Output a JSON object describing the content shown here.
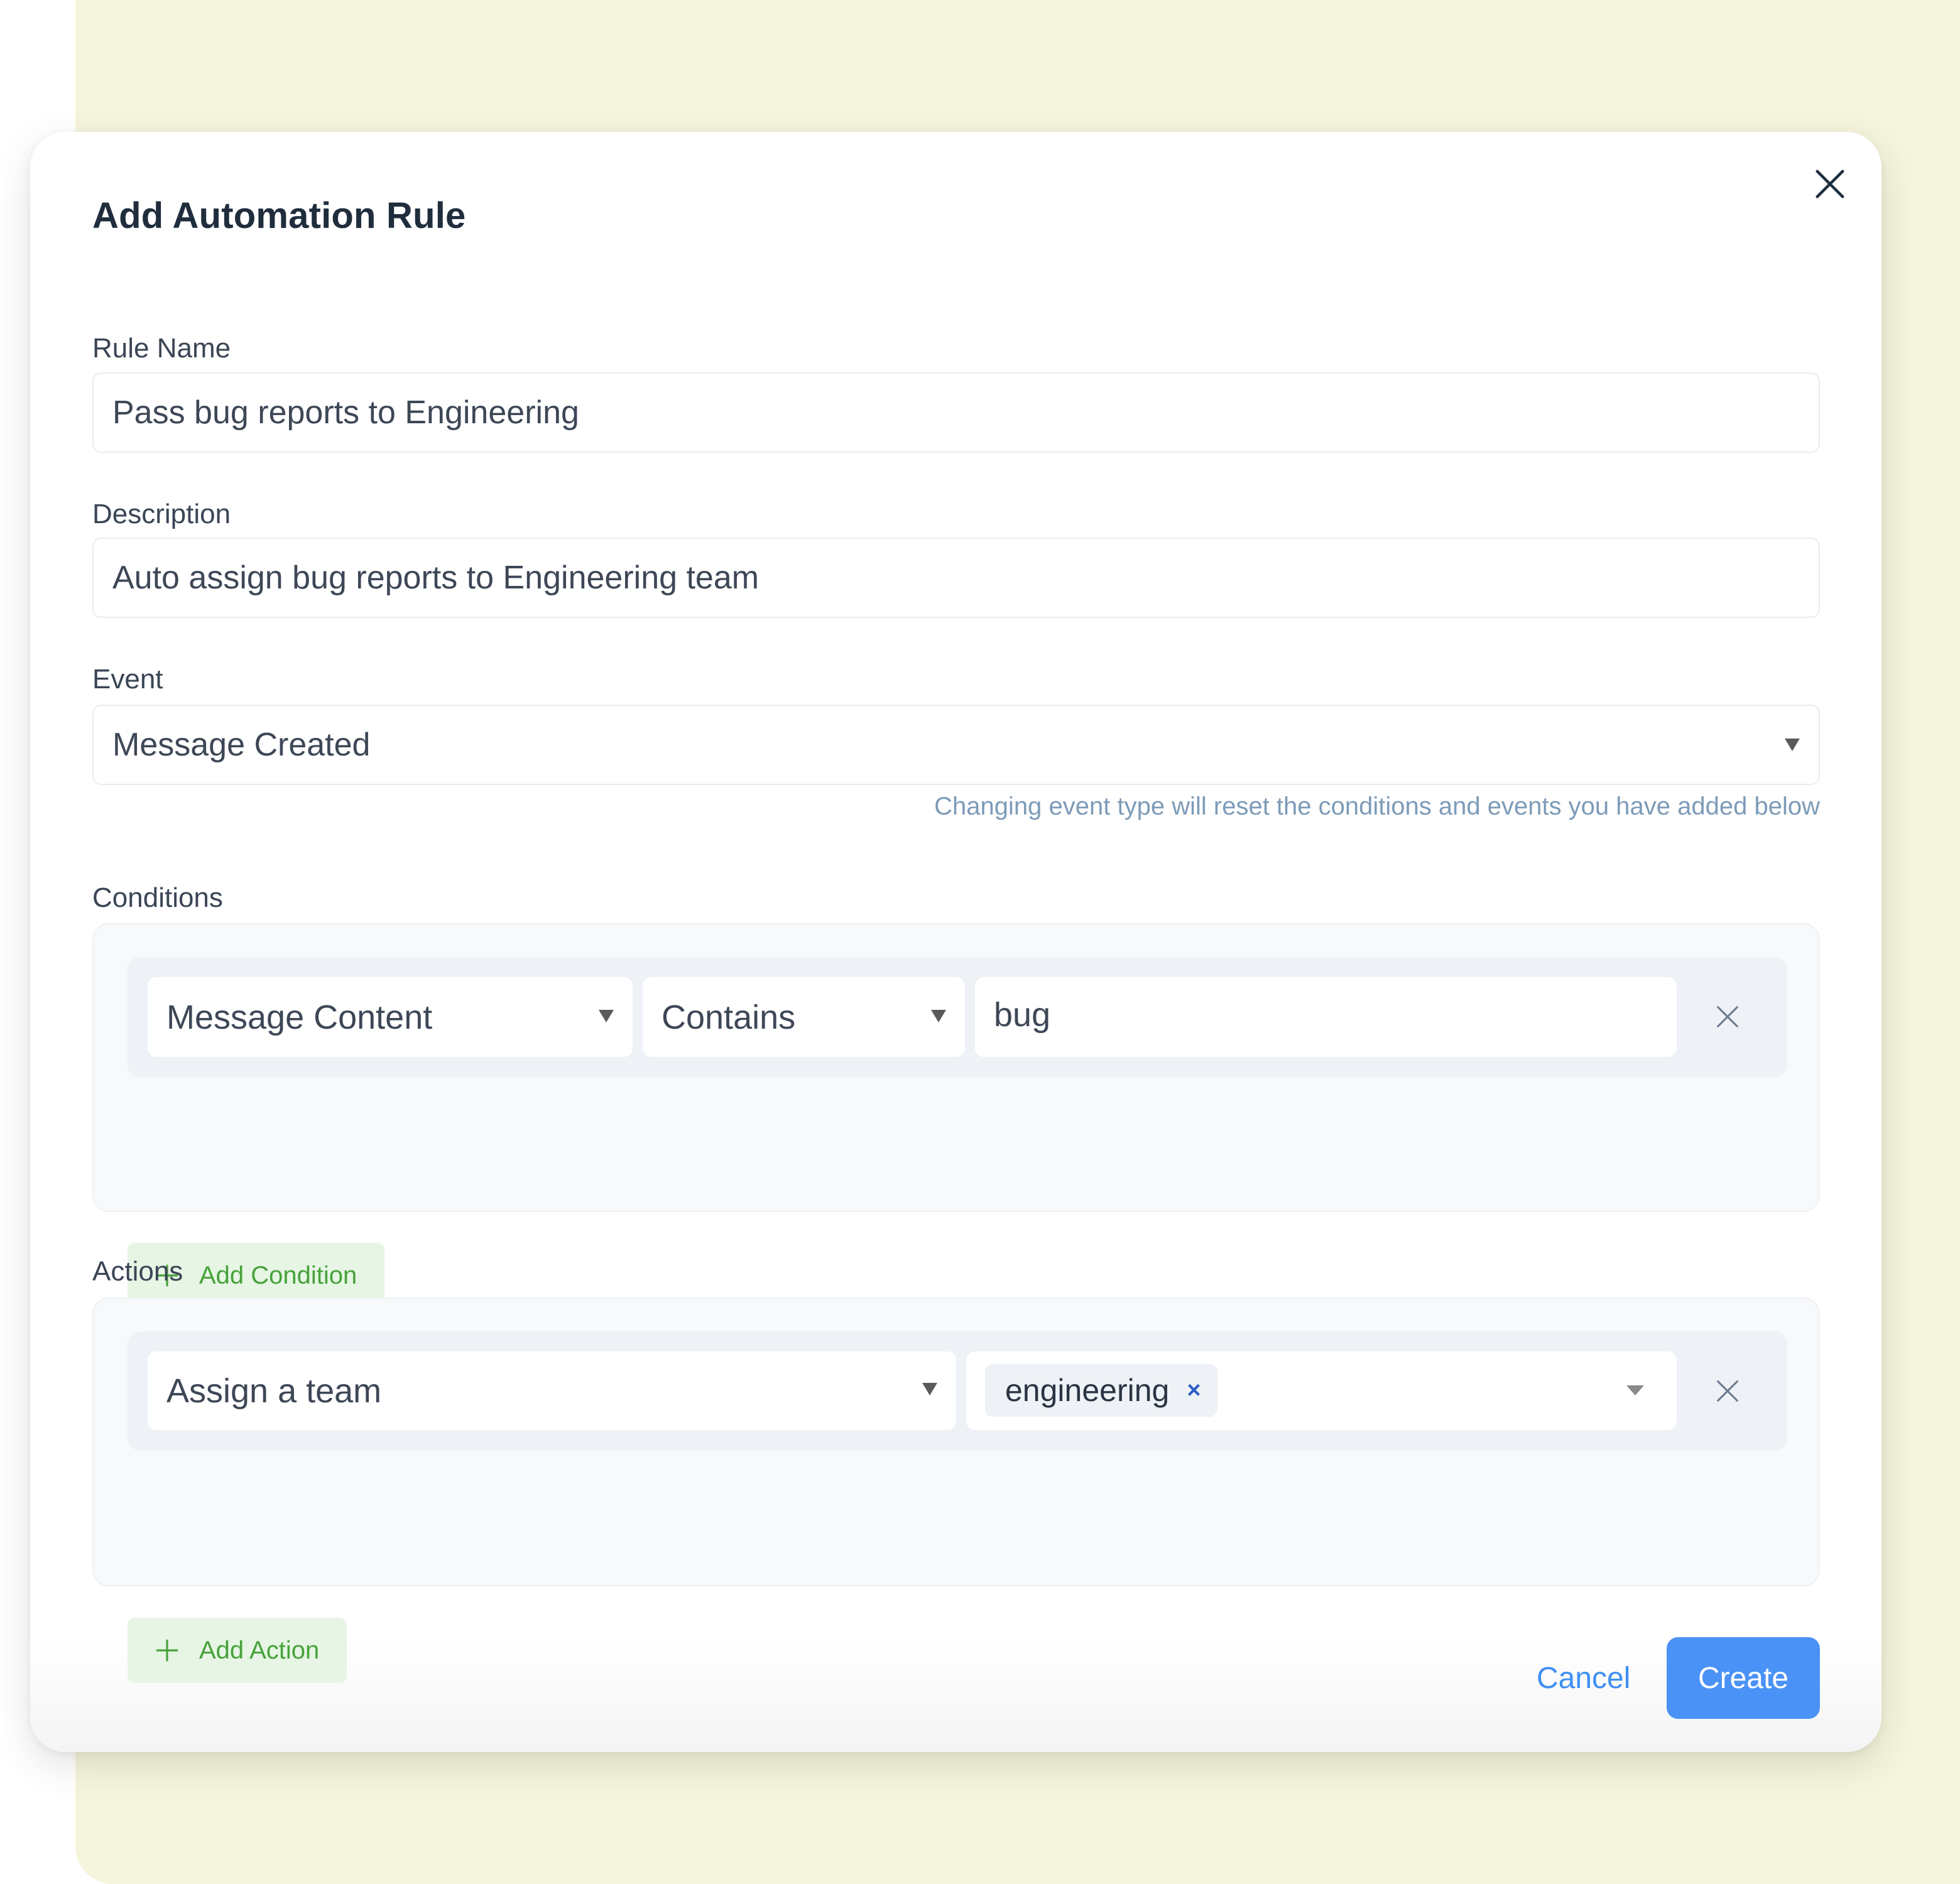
{
  "dialog": {
    "title": "Add Automation Rule",
    "close_icon": "close-icon"
  },
  "rule_name": {
    "label": "Rule Name",
    "value": "Pass bug reports to Engineering"
  },
  "description": {
    "label": "Description",
    "value": "Auto assign bug reports to Engineering team"
  },
  "event": {
    "label": "Event",
    "selected": "Message Created",
    "hint": "Changing event type will reset the conditions and events you have added below"
  },
  "conditions": {
    "label": "Conditions",
    "rows": [
      {
        "attribute": "Message Content",
        "operator": "Contains",
        "value": "bug"
      }
    ],
    "add_label": "Add Condition"
  },
  "actions": {
    "label": "Actions",
    "rows": [
      {
        "action": "Assign a team",
        "tags": [
          "engineering"
        ],
        "tag_remove_glyph": "×"
      }
    ],
    "add_label": "Add Action"
  },
  "footer": {
    "cancel_label": "Cancel",
    "create_label": "Create"
  },
  "colors": {
    "backdrop": "#f5f4dc",
    "primary": "#4a92f6",
    "add_button_bg": "#e6f5e4",
    "add_button_text": "#47a23a",
    "hint_text": "#7d9bb8",
    "tag_remove": "#2b5fc4"
  }
}
